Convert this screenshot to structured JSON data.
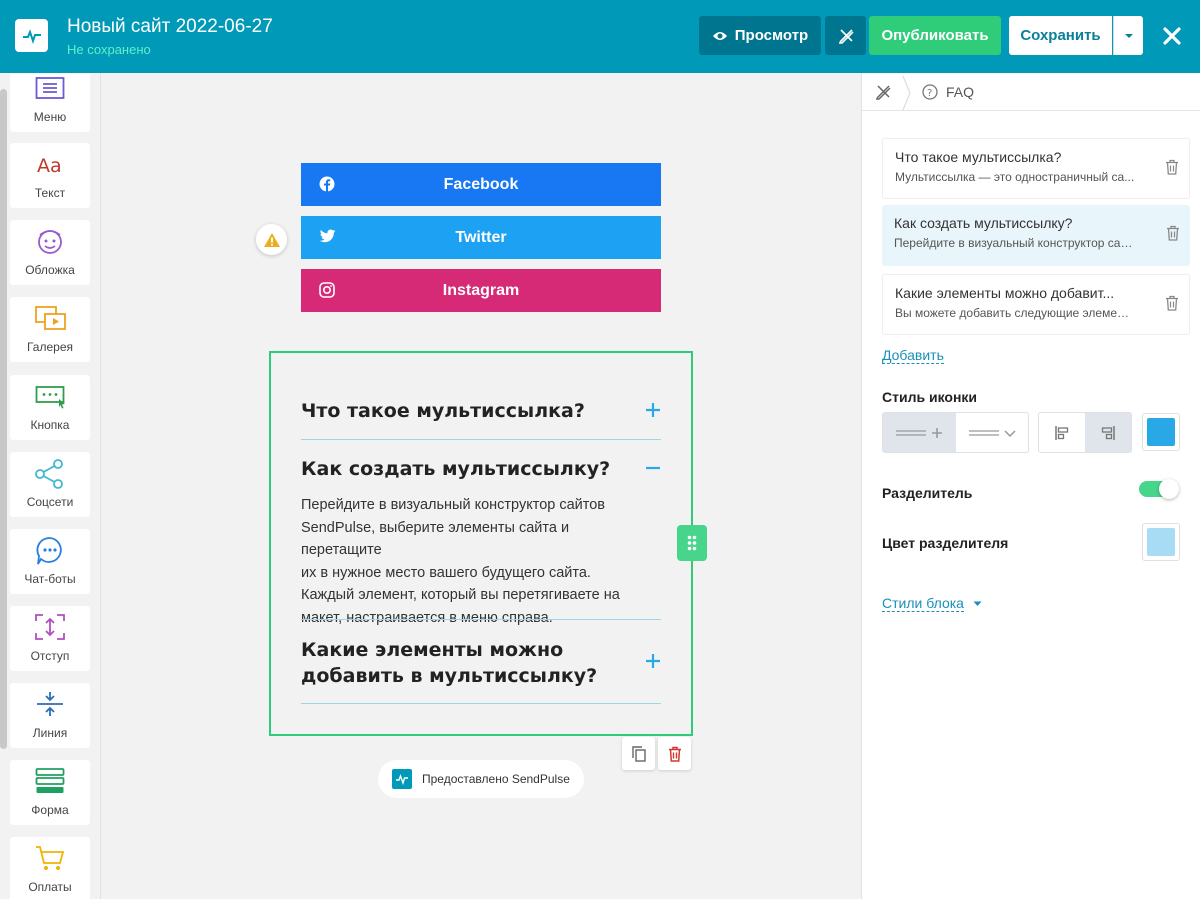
{
  "header": {
    "site_title": "Новый сайт 2022-06-27",
    "status": "Не сохранено",
    "preview_label": "Просмотр",
    "publish_label": "Опубликовать",
    "save_label": "Сохранить"
  },
  "sidebar": {
    "items": [
      {
        "label": "Меню",
        "icon": "menu-icon",
        "color": "#6a5bd6"
      },
      {
        "label": "Текст",
        "icon": "text-icon",
        "color": "#c0392b"
      },
      {
        "label": "Обложка",
        "icon": "cover-icon",
        "color": "#9b59d0"
      },
      {
        "label": "Галерея",
        "icon": "gallery-icon",
        "color": "#f0a020"
      },
      {
        "label": "Кнопка",
        "icon": "button-icon",
        "color": "#2e9e4a"
      },
      {
        "label": "Соцсети",
        "icon": "share-icon",
        "color": "#3fb8d0"
      },
      {
        "label": "Чат-боты",
        "icon": "chatbot-icon",
        "color": "#2a7de1"
      },
      {
        "label": "Отступ",
        "icon": "spacing-icon",
        "color": "#b04fc0"
      },
      {
        "label": "Линия",
        "icon": "line-icon",
        "color": "#2a6db8"
      },
      {
        "label": "Форма",
        "icon": "form-icon",
        "color": "#1fa060"
      },
      {
        "label": "Оплаты",
        "icon": "cart-icon",
        "color": "#f0b400"
      }
    ]
  },
  "canvas": {
    "social": [
      {
        "label": "Facebook",
        "color": "#1877f2"
      },
      {
        "label": "Twitter",
        "color": "#1da1f2"
      },
      {
        "label": "Instagram",
        "color": "#d62976"
      }
    ],
    "faq": [
      {
        "question": "Что такое мультиссылка?",
        "expanded": false
      },
      {
        "question": "Как создать мультиссылку?",
        "expanded": true
      },
      {
        "question_line1": "Какие элементы можно",
        "question_line2": "добавить в мультиссылку?",
        "expanded": false
      }
    ],
    "answer_lines": [
      "Перейдите в визуальный конструктор сайтов",
      "SendPulse, выберите элементы сайта и перетащите",
      "их в нужное место вашего будущего сайта.",
      "Каждый элемент, который вы перетягиваете на",
      "макет, настраивается в меню справа."
    ],
    "powered_by": "Предоставлено SendPulse"
  },
  "panel": {
    "breadcrumb": "FAQ",
    "faq_items": [
      {
        "question": "Что такое мультиссылка?",
        "answer": "Мультиссылка — это одностраничный са..."
      },
      {
        "question": "Как создать мультиссылку?",
        "answer": "Перейдите в визуальный конструктор сайт..."
      },
      {
        "question": "Какие элементы можно добавит...",
        "answer": "Вы можете добавить следующие элемент..."
      }
    ],
    "add_label": "Добавить",
    "icon_style_label": "Стиль иконки",
    "divider_label": "Разделитель",
    "divider_color_label": "Цвет разделителя",
    "block_styles_label": "Стили блока",
    "icon_color": "#29a8e8",
    "divider_color": "#a8dcf5",
    "divider_enabled": true
  }
}
